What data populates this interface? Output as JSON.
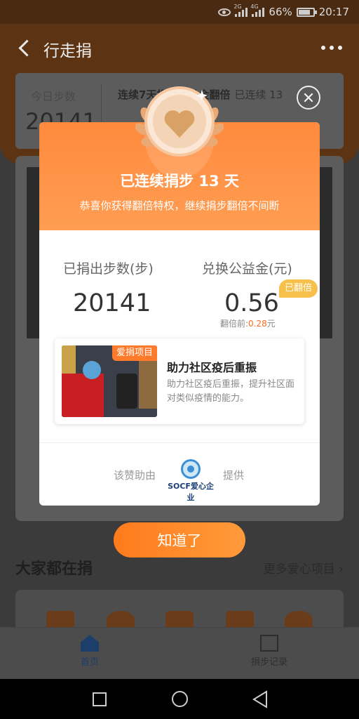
{
  "status_bar": {
    "net1": "2G",
    "net2": "4G",
    "battery": "66%",
    "time": "20:17"
  },
  "header": {
    "title": "行走捐"
  },
  "background": {
    "today_steps_label": "今日步数",
    "today_steps_value": "20141",
    "streak_heading": "连续7天捐步公益金翻倍",
    "streak_status": "已连续 13",
    "section_title": "大家都在捐",
    "more_projects": "更多爱心项目 ›"
  },
  "tabs": [
    {
      "label": "首页",
      "icon": "home-icon",
      "active": true
    },
    {
      "label": "捐步记录",
      "icon": "record-icon",
      "active": false
    }
  ],
  "modal": {
    "title": "已连续捐步 13 天",
    "subtitle": "恭喜你获得翻倍特权，继续捐步翻倍不间断",
    "steps_label": "已捐出步数(步)",
    "steps_value": "20141",
    "fund_label": "兑换公益金(元)",
    "fund_value": "0.56",
    "doubled_badge": "已翻倍",
    "before_label": "翻倍前:",
    "before_value": "0.28",
    "before_unit": "元",
    "project": {
      "tag": "爱捐项目",
      "name": "助力社区疫后重振",
      "description": "助力社区疫后重振，提升社区面对类似疫情的能力。"
    },
    "sponsor_prefix": "该赞助由",
    "sponsor_name": "SOCF爱心企业",
    "sponsor_suffix": "提供",
    "confirm_button": "知道了"
  },
  "colors": {
    "accent": "#ff7b1c",
    "gold": "#f7c04a"
  }
}
